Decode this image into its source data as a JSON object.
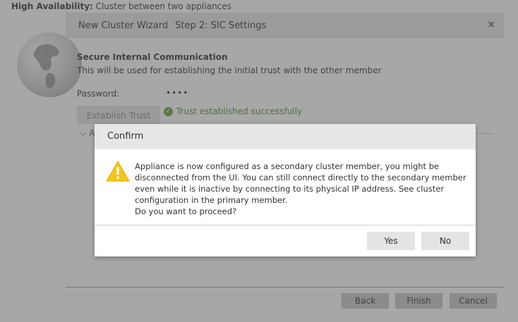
{
  "page_header": {
    "label": "High Availability:",
    "value": " Cluster between two appliances"
  },
  "wizard": {
    "title": "New Cluster Wizard",
    "step": "Step 2: SIC Settings",
    "close_icon": "×",
    "section_title": "Secure Internal Communication",
    "section_desc": "This will be used for establishing the initial trust with the other member",
    "password_label": "Password:",
    "password_value": "••••",
    "establish_button": "Establish Trust",
    "trust_status": "Trust established successfully",
    "advanced_prefix": "A",
    "footer": {
      "back": "Back",
      "finish": "Finish",
      "cancel": "Cancel"
    }
  },
  "confirm": {
    "title": "Confirm",
    "message_lines": [
      "Appliance is now configured as a secondary cluster member, you might be",
      "disconnected from the UI. You can still connect directly to the secondary member",
      "even while it is inactive by connecting to its physical IP address. See cluster",
      "configuration in the primary member.",
      "Do you want to proceed?"
    ],
    "yes": "Yes",
    "no": "No"
  },
  "icons": {
    "globe": "globe-icon",
    "check": "check-circle-icon",
    "warning": "warning-icon",
    "close": "close-icon",
    "chevron": "chevron-down-icon"
  },
  "colors": {
    "success": "#4b8f29",
    "warning": "#f5c518",
    "overlay": "#505050"
  }
}
